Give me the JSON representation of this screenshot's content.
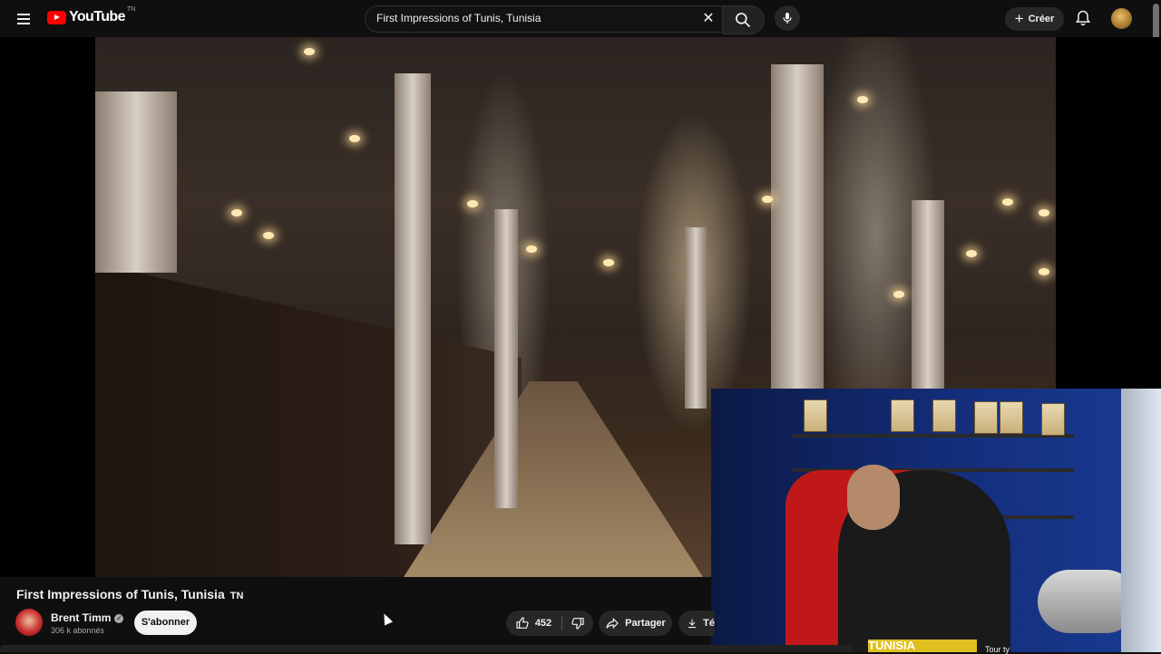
{
  "header": {
    "logo_text": "YouTube",
    "country_code": "TN",
    "search_query": "First Impressions of Tunis, Tunisia",
    "create_label": "Créer",
    "icons": [
      "menu-icon",
      "clear-icon",
      "search-icon",
      "mic-icon",
      "bell-icon"
    ]
  },
  "video": {
    "title": "First Impressions of Tunis, Tunisia",
    "title_flag": "TN"
  },
  "channel": {
    "name": "Brent Timm",
    "subscribers": "306 k abonnés",
    "subscribe_label": "S'abonner"
  },
  "actions": {
    "likes": "452",
    "share_label": "Partager",
    "download_label": "Té"
  },
  "recommendation_peek": {
    "thumb_text": "TUNISIA",
    "text": "Tour ty"
  },
  "colors": {
    "background": "#0f0f0f",
    "brand_red": "#ff0000",
    "button_bg": "#272727",
    "subscribe_bg": "#f1f1f1"
  }
}
